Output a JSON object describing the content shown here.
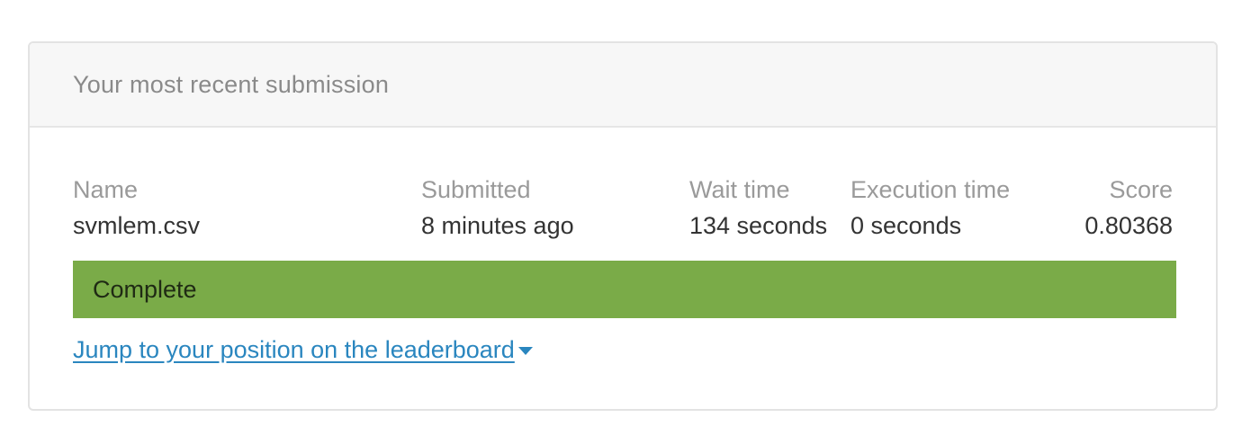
{
  "card": {
    "title": "Your most recent submission"
  },
  "submission": {
    "columns": {
      "name": {
        "label": "Name",
        "value": "svmlem.csv"
      },
      "submitted": {
        "label": "Submitted",
        "value": "8 minutes ago"
      },
      "wait_time": {
        "label": "Wait time",
        "value": "134 seconds"
      },
      "execution_time": {
        "label": "Execution time",
        "value": "0 seconds"
      },
      "score": {
        "label": "Score",
        "value": "0.80368"
      }
    },
    "status": "Complete",
    "status_color": "#7aab48"
  },
  "link": {
    "text": "Jump to your position on the leaderboard",
    "icon": "caret-down-icon",
    "color": "#2a86bf"
  }
}
